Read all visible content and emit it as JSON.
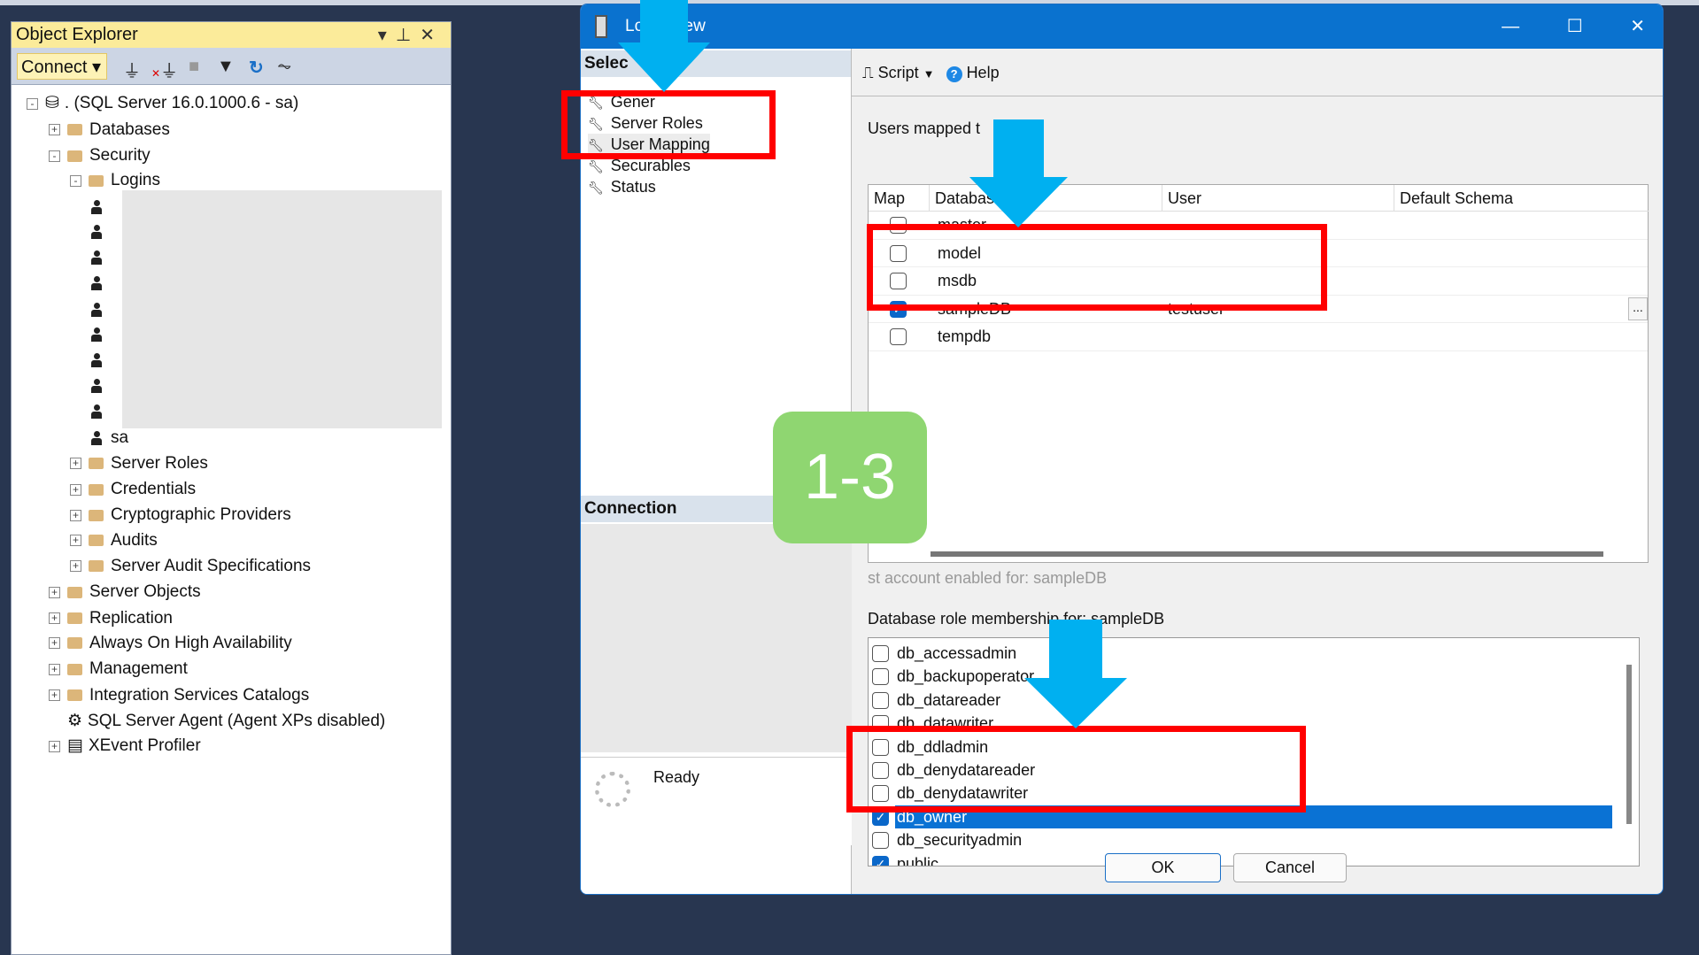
{
  "object_explorer": {
    "title": "Object Explorer",
    "connect_label": "Connect",
    "tree": [
      {
        "label": ". (SQL Server 16.0.1000.6 - sa)",
        "level": 0,
        "exp": "-",
        "icon": "server"
      },
      {
        "label": "Databases",
        "level": 1,
        "exp": "+",
        "icon": "folder"
      },
      {
        "label": "Security",
        "level": 1,
        "exp": "-",
        "icon": "folder"
      },
      {
        "label": "Logins",
        "level": 2,
        "exp": "-",
        "icon": "folder"
      },
      {
        "label": "",
        "level": 3,
        "icon": "login"
      },
      {
        "label": "",
        "level": 3,
        "icon": "login"
      },
      {
        "label": "",
        "level": 3,
        "icon": "login"
      },
      {
        "label": "",
        "level": 3,
        "icon": "login"
      },
      {
        "label": "",
        "level": 3,
        "icon": "login"
      },
      {
        "label": "",
        "level": 3,
        "icon": "login"
      },
      {
        "label": "",
        "level": 3,
        "icon": "login"
      },
      {
        "label": "",
        "level": 3,
        "icon": "login"
      },
      {
        "label": "",
        "level": 3,
        "icon": "login"
      },
      {
        "label": "sa",
        "level": 3,
        "icon": "login"
      },
      {
        "label": "Server Roles",
        "level": 2,
        "exp": "+",
        "icon": "folder"
      },
      {
        "label": "Credentials",
        "level": 2,
        "exp": "+",
        "icon": "folder"
      },
      {
        "label": "Cryptographic Providers",
        "level": 2,
        "exp": "+",
        "icon": "folder"
      },
      {
        "label": "Audits",
        "level": 2,
        "exp": "+",
        "icon": "folder"
      },
      {
        "label": "Server Audit Specifications",
        "level": 2,
        "exp": "+",
        "icon": "folder"
      },
      {
        "label": "Server Objects",
        "level": 1,
        "exp": "+",
        "icon": "folder"
      },
      {
        "label": "Replication",
        "level": 1,
        "exp": "+",
        "icon": "folder"
      },
      {
        "label": "Always On High Availability",
        "level": 1,
        "exp": "+",
        "icon": "folder"
      },
      {
        "label": "Management",
        "level": 1,
        "exp": "+",
        "icon": "folder"
      },
      {
        "label": "Integration Services Catalogs",
        "level": 1,
        "exp": "+",
        "icon": "folder"
      },
      {
        "label": "SQL Server Agent (Agent XPs disabled)",
        "level": 1,
        "icon": "agent"
      },
      {
        "label": "XEvent Profiler",
        "level": 1,
        "exp": "+",
        "icon": "xevent"
      }
    ]
  },
  "dialog": {
    "title_visible": "Lo      New",
    "select_page": "Selec        ge",
    "pages": [
      "Gener",
      "Server Roles",
      "User Mapping",
      "Securables",
      "Status"
    ],
    "connection_header": "Connection",
    "status": "Ready",
    "toolbar": {
      "script": "Script",
      "help": "Help"
    },
    "users_mapped_label": "Users mapped t      ogin:",
    "columns": [
      "Map",
      "Databas",
      "User",
      "Default Schema"
    ],
    "databases": [
      {
        "name": "master",
        "checked": false,
        "user": ""
      },
      {
        "name": "model",
        "checked": false,
        "user": ""
      },
      {
        "name": "msdb",
        "checked": false,
        "user": ""
      },
      {
        "name": "sampleDB",
        "checked": true,
        "user": "testuser"
      },
      {
        "name": "tempdb",
        "checked": false,
        "user": ""
      }
    ],
    "ellipsis": "...",
    "guest_label": "st account enabled for: sampleDB",
    "role_label": "Database role membership for: sampleDB",
    "roles": [
      {
        "name": "db_accessadmin",
        "checked": false
      },
      {
        "name": "db_backupoperator",
        "checked": false
      },
      {
        "name": "db_datareader",
        "checked": false
      },
      {
        "name": "db_datawriter",
        "checked": false
      },
      {
        "name": "db_ddladmin",
        "checked": false
      },
      {
        "name": "db_denydatareader",
        "checked": false
      },
      {
        "name": "db_denydatawriter",
        "checked": false
      },
      {
        "name": "db_owner",
        "checked": true,
        "selected": true
      },
      {
        "name": "db_securityadmin",
        "checked": false
      },
      {
        "name": "public",
        "checked": true
      }
    ],
    "ok": "OK",
    "cancel": "Cancel"
  },
  "annotation": {
    "badge": "1-3",
    "highlight_color": "#ff0000",
    "arrow_color": "#00b0f0",
    "badge_color": "#8fd671"
  }
}
